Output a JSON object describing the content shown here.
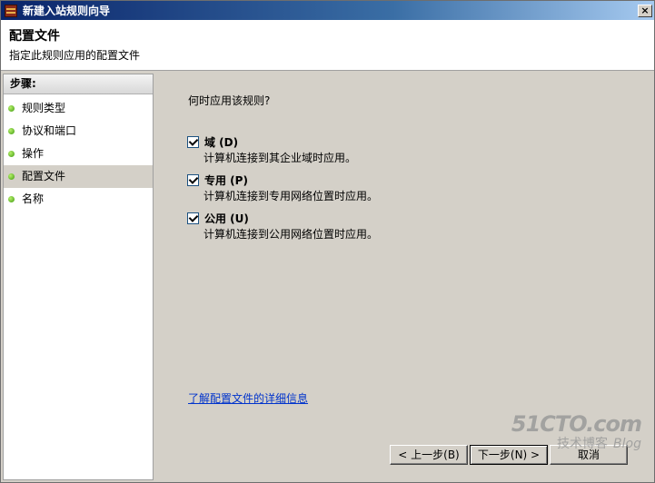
{
  "window": {
    "title": "新建入站规则向导",
    "close_glyph": "×"
  },
  "header": {
    "title": "配置文件",
    "subtitle": "指定此规则应用的配置文件"
  },
  "steps": {
    "heading": "步骤:",
    "items": [
      {
        "label": "规则类型",
        "active": false
      },
      {
        "label": "协议和端口",
        "active": false
      },
      {
        "label": "操作",
        "active": false
      },
      {
        "label": "配置文件",
        "active": true
      },
      {
        "label": "名称",
        "active": false
      }
    ]
  },
  "main": {
    "question": "何时应用该规则?",
    "options": [
      {
        "label": "域 (D)",
        "description": "计算机连接到其企业域时应用。",
        "checked": true
      },
      {
        "label": "专用 (P)",
        "description": "计算机连接到专用网络位置时应用。",
        "checked": true
      },
      {
        "label": "公用 (U)",
        "description": "计算机连接到公用网络位置时应用。",
        "checked": true
      }
    ],
    "info_link": "了解配置文件的详细信息"
  },
  "buttons": {
    "back": "< 上一步(B)",
    "next": "下一步(N) >",
    "cancel": "取消"
  },
  "watermark": {
    "main": "51CTO.com",
    "sub": "技术博客",
    "sub2": "Blog"
  },
  "icons": {
    "app": "firewall-icon",
    "close": "close-icon",
    "step_bullet": "green-dot-icon",
    "checkbox": "checkbox-icon"
  }
}
